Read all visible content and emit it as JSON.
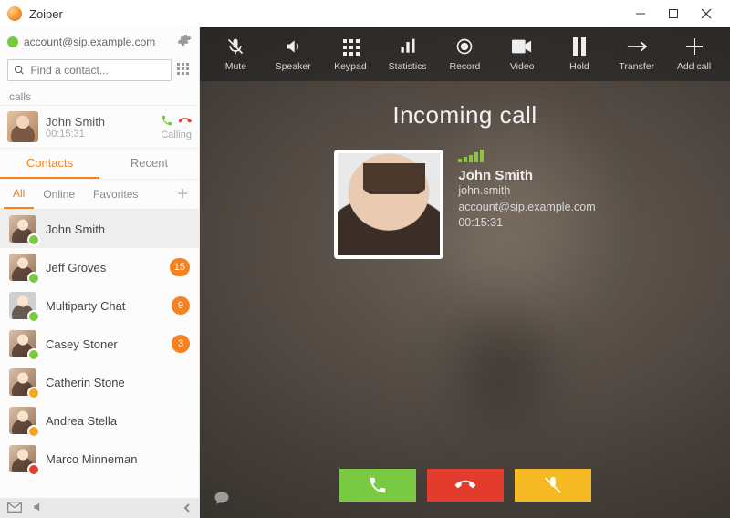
{
  "titlebar": {
    "title": "Zoiper"
  },
  "account": {
    "text": "account@sip.example.com"
  },
  "search": {
    "placeholder": "Find a contact..."
  },
  "calls_label": "calls",
  "active_call": {
    "name": "John Smith",
    "time": "00:15:31",
    "status": "Calling"
  },
  "tabs_primary": {
    "contacts": "Contacts",
    "recent": "Recent"
  },
  "tabs_filter": {
    "all": "All",
    "online": "Online",
    "favorites": "Favorites"
  },
  "contacts": [
    {
      "name": "John Smith",
      "presence": "green",
      "badge": "",
      "avatar": "photo",
      "selected": true
    },
    {
      "name": "Jeff Groves",
      "presence": "green",
      "badge": "15",
      "avatar": "photo",
      "selected": false
    },
    {
      "name": "Multiparty Chat",
      "presence": "green",
      "badge": "9",
      "avatar": "gray",
      "selected": false
    },
    {
      "name": "Casey Stoner",
      "presence": "green",
      "badge": "3",
      "avatar": "photo",
      "selected": false
    },
    {
      "name": "Catherin Stone",
      "presence": "orange",
      "badge": "",
      "avatar": "photo",
      "selected": false
    },
    {
      "name": "Andrea Stella",
      "presence": "orange",
      "badge": "",
      "avatar": "photo",
      "selected": false
    },
    {
      "name": "Marco Minneman",
      "presence": "red",
      "badge": "",
      "avatar": "photo",
      "selected": false
    }
  ],
  "toolbar": {
    "mute": "Mute",
    "speaker": "Speaker",
    "keypad": "Keypad",
    "statistics": "Statistics",
    "record": "Record",
    "video": "Video",
    "hold": "Hold",
    "transfer": "Transfer",
    "addcall": "Add call"
  },
  "incoming": {
    "title": "Incoming call",
    "name": "John Smith",
    "user": "john.smith",
    "account": "account@sip.example.com",
    "time": "00:15:31"
  }
}
